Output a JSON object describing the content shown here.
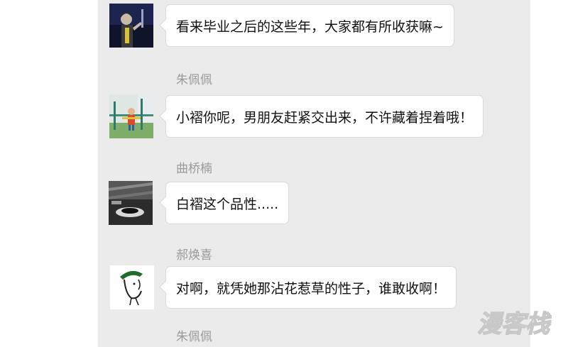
{
  "messages": [
    {
      "sender": "",
      "text": "看来毕业之后的这些年，大家都有所收获嘛~",
      "avatar": "performer-stage-photo"
    },
    {
      "sender": "朱佩佩",
      "text": "小褶你呢，男朋友赶紧交出来，不许藏着捏着哦！",
      "avatar": "child-playground-photo"
    },
    {
      "sender": "曲桥楠",
      "text": "白褶这个品性.....",
      "avatar": "coffee-cup-bw-photo"
    },
    {
      "sender": "郝焕喜",
      "text": "对啊，就凭她那沾花惹草的性子，谁敢收啊！",
      "avatar": "cartoon-face-sketch"
    }
  ],
  "trailing_sender": "朱佩佩",
  "watermark": {
    "text": "漫客栈",
    "style": "logo"
  },
  "colors": {
    "panel": "#ebebeb",
    "bubble": "#ffffff",
    "bubble_border": "#dadada",
    "sender_name": "#9a9a9a",
    "message_text": "#111111"
  }
}
